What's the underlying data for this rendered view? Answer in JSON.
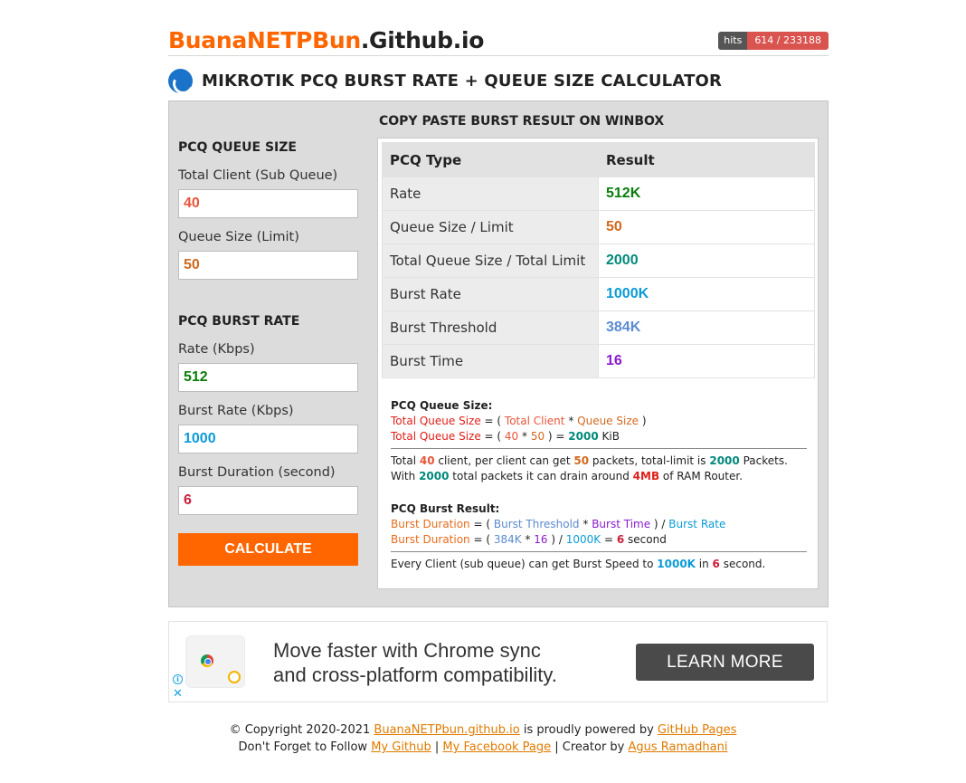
{
  "header": {
    "site_title_part1": "BuanaNETPBun",
    "site_title_part2": ".Github.io",
    "hits_label": "hits",
    "hits_value": "614 / 233188"
  },
  "page_title": "MIKROTIK PCQ BURST RATE + QUEUE SIZE CALCULATOR",
  "form": {
    "queue_size_title": "PCQ QUEUE SIZE",
    "total_client_label": "Total Client (Sub Queue)",
    "total_client_value": "40",
    "queue_size_label": "Queue Size (Limit)",
    "queue_size_value": "50",
    "burst_rate_title": "PCQ BURST RATE",
    "rate_label": "Rate (Kbps)",
    "rate_value": "512",
    "burst_rate_label": "Burst Rate (Kbps)",
    "burst_rate_value": "1000",
    "burst_duration_label": "Burst Duration (second)",
    "burst_duration_value": "6",
    "calculate_label": "CALCULATE"
  },
  "result": {
    "title": "COPY PASTE BURST RESULT ON WINBOX",
    "col_type": "PCQ Type",
    "col_result": "Result",
    "rows": [
      {
        "key": "Rate",
        "value": "512K"
      },
      {
        "key": "Queue Size / Limit",
        "value": "50"
      },
      {
        "key": "Total Queue Size / Total Limit",
        "value": "2000"
      },
      {
        "key": "Burst Rate",
        "value": "1000K"
      },
      {
        "key": "Burst Threshold",
        "value": "384K"
      },
      {
        "key": "Burst Time",
        "value": "16"
      }
    ]
  },
  "notes": {
    "queue_head": "PCQ Queue Size:",
    "tqs": "Total Queue Size",
    "eq": " = ( ",
    "total_client": "Total Client",
    "star": " * ",
    "queue_size": "Queue Size",
    "close": " )",
    "open2": " = ( ",
    "n40": "40",
    "n50": "50",
    "close_eq": " ) = ",
    "n2000": "2000",
    "kib": " KiB",
    "l1a": "Total ",
    "l1b": " client, per client can get ",
    "l1c": " packets, total-limit is ",
    "l1d": " Packets.",
    "l2a": "With ",
    "l2b": " total packets it can drain around ",
    "l2c": "4MB",
    "l2d": " of RAM Router.",
    "burst_head": "PCQ Burst Result:",
    "bd": "Burst Duration",
    "bt": "Burst Threshold",
    "btime": "Burst Time",
    "slash_open": " ) / ",
    "br": "Burst Rate",
    "v384": "384K",
    "v16": "16",
    "v1000": "1000K",
    "v6": "6",
    "second": " second",
    "l3a": "Every Client (sub queue) can get Burst Speed to ",
    "l3b": " in ",
    "l3c": " second."
  },
  "ad": {
    "line1": "Move faster with Chrome sync",
    "line2": "and cross-platform compatibility.",
    "button": "LEARN MORE",
    "info": "i",
    "close": "✕"
  },
  "footer": {
    "copy": "© Copyright 2020-2021 ",
    "site_link": "BuanaNETPbun.github.io",
    "powered": " is proudly powered by ",
    "gh_pages": "GitHub Pages",
    "follow": "Don't Forget to Follow ",
    "my_github": "My Github",
    "sep1": " | ",
    "my_fb": "My Facebook Page",
    "creator": " | Creator by ",
    "author": "Agus Ramadhani"
  }
}
